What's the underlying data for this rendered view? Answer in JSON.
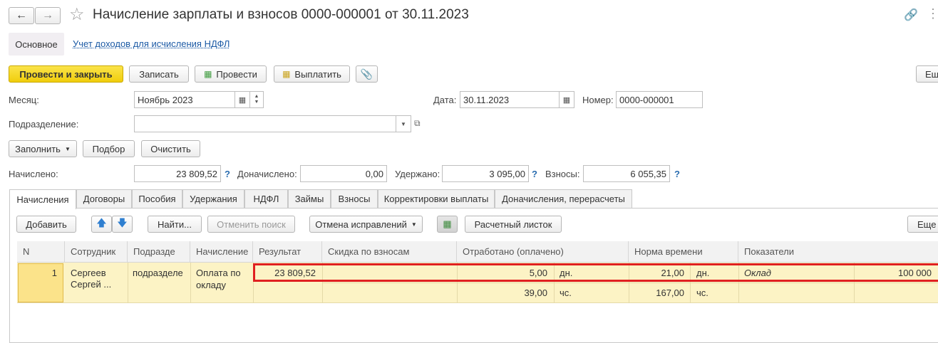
{
  "window": {
    "title": "Начисление зарплаты и взносов 0000-000001 от 30.11.2023"
  },
  "subnav": {
    "main": "Основное",
    "link": "Учет доходов для исчисления НДФЛ"
  },
  "toolbar": {
    "post_close": "Провести и закрыть",
    "save": "Записать",
    "post": "Провести",
    "pay": "Выплатить",
    "more": "Еще"
  },
  "form": {
    "month_label": "Месяц:",
    "month_value": "Ноябрь 2023",
    "date_label": "Дата:",
    "date_value": "30.11.2023",
    "number_label": "Номер:",
    "number_value": "0000-000001",
    "dept_label": "Подразделение:",
    "dept_value": ""
  },
  "actions": {
    "fill": "Заполнить",
    "pick": "Подбор",
    "clear": "Очистить"
  },
  "totals": {
    "accrued_label": "Начислено:",
    "accrued_value": "23 809,52",
    "extra_label": "Доначислено:",
    "extra_value": "0,00",
    "withheld_label": "Удержано:",
    "withheld_value": "3 095,00",
    "contrib_label": "Взносы:",
    "contrib_value": "6 055,35",
    "help": "?"
  },
  "tabs": [
    {
      "label": "Начисления"
    },
    {
      "label": "Договоры"
    },
    {
      "label": "Пособия"
    },
    {
      "label": "Удержания"
    },
    {
      "label": "НДФЛ"
    },
    {
      "label": "Займы"
    },
    {
      "label": "Взносы"
    },
    {
      "label": "Корректировки выплаты"
    },
    {
      "label": "Доначисления, перерасчеты"
    }
  ],
  "table_toolbar": {
    "add": "Добавить",
    "find": "Найти...",
    "cancel_search": "Отменить поиск",
    "cancel_fix": "Отмена исправлений",
    "payslip": "Расчетный листок",
    "more": "Еще"
  },
  "table": {
    "columns": [
      "N",
      "Сотрудник",
      "Подразде",
      "Начисление",
      "Результат",
      "Скидка по взносам",
      "Отработано (оплачено)",
      "Норма времени",
      "Показатели"
    ],
    "row": {
      "n": "1",
      "employee_line1": "Сергеев",
      "employee_line2": "Сергей ...",
      "dept": "подразделе",
      "accrual_line1": "Оплата по",
      "accrual_line2": "окладу",
      "result": "23 809,52",
      "worked_days": "5,00",
      "worked_days_unit": "дн.",
      "worked_hours": "39,00",
      "worked_hours_unit": "чс.",
      "norm_days": "21,00",
      "norm_days_unit": "дн.",
      "norm_hours": "167,00",
      "norm_hours_unit": "чс.",
      "indicator": "Оклад",
      "indicator_value": "100 000"
    }
  },
  "colors": {
    "accent_yellow": "#f5d31e",
    "row_yellow": "#fcf3c5",
    "highlight_red": "#e02020"
  }
}
